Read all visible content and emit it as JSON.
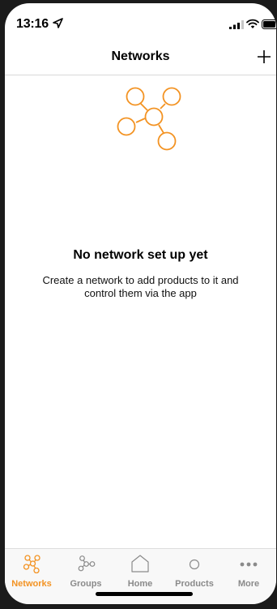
{
  "status_bar": {
    "time": "13:16",
    "icons": [
      "location-arrow-icon",
      "signal-icon",
      "wifi-icon",
      "battery-icon"
    ]
  },
  "nav": {
    "title": "Networks",
    "add_icon": "plus-icon"
  },
  "empty_state": {
    "illustration": "network-nodes-icon",
    "title": "No network set up yet",
    "description": "Create a network to add products to it and control them via the app"
  },
  "tab_bar": {
    "tabs": [
      {
        "label": "Networks",
        "icon": "network-nodes-icon",
        "active": true
      },
      {
        "label": "Groups",
        "icon": "groups-icon",
        "active": false
      },
      {
        "label": "Home",
        "icon": "home-icon",
        "active": false
      },
      {
        "label": "Products",
        "icon": "product-circle-icon",
        "active": false
      },
      {
        "label": "More",
        "icon": "more-dots-icon",
        "active": false
      }
    ]
  },
  "colors": {
    "accent": "#f39323",
    "inactive": "#8a8a8a",
    "background": "#ffffff"
  }
}
